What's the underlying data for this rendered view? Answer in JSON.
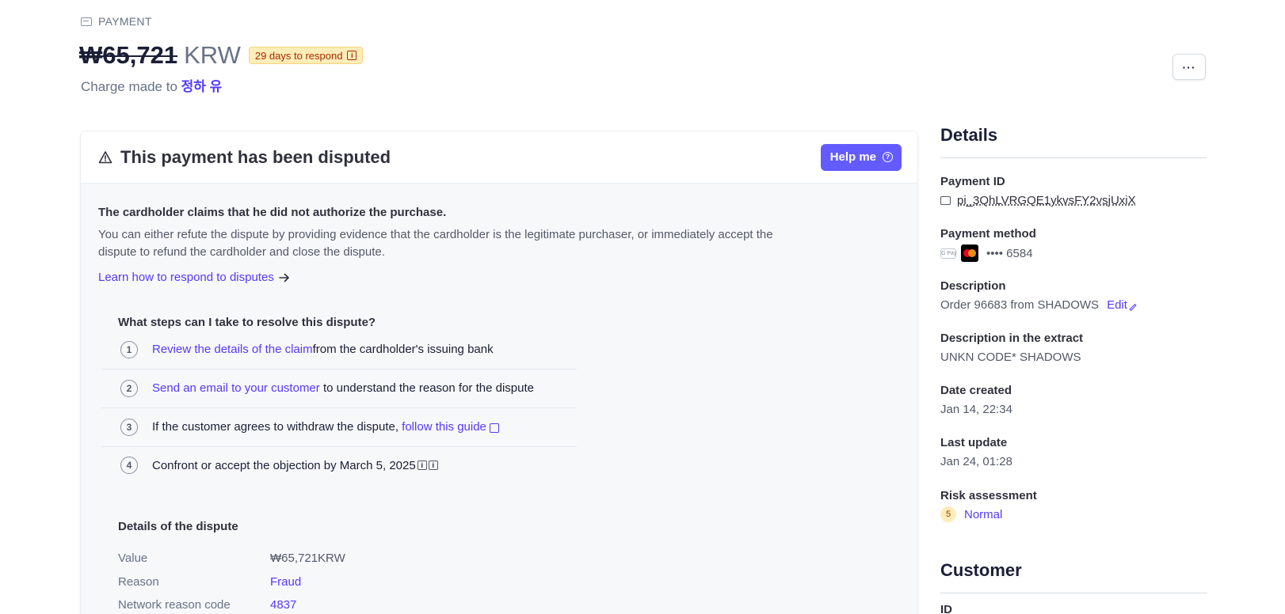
{
  "header": {
    "eyebrow": "PAYMENT",
    "amount": "₩65,721",
    "currency": "KRW",
    "deadline_badge": "29 days to respond",
    "charge_prefix": "Charge made to",
    "customer_name": "정하 유",
    "more_label": "···"
  },
  "dispute": {
    "title": "This payment has been disputed",
    "help_label": "Help me",
    "claim": "The cardholder claims that he did not authorize the purchase.",
    "explanation": "You can either refute the dispute by providing evidence that the cardholder is the legitimate purchaser, or immediately accept the dispute to refund the cardholder and close the dispute.",
    "learn_link": "Learn how to respond to disputes",
    "steps_title": "What steps can I take to resolve this dispute?",
    "steps": [
      {
        "number": "1",
        "link": "Review the details of the claim",
        "text": "from the cardholder's issuing bank"
      },
      {
        "number": "2",
        "link": "Send an email to your customer",
        "text": " to understand the reason for the dispute"
      },
      {
        "number": "3",
        "text": "If the customer agrees to withdraw the dispute, ",
        "link": "follow this guide"
      },
      {
        "number": "4",
        "text": "Confront or accept the objection by March 5, 2025"
      }
    ],
    "details_title": "Details of the dispute",
    "details": [
      {
        "label": "Value",
        "value": "₩65,721KRW"
      },
      {
        "label": "Reason",
        "value": "Fraud"
      },
      {
        "label": "Network reason code",
        "value": "4837"
      }
    ]
  },
  "details_panel": {
    "title": "Details",
    "payment_id_label": "Payment ID",
    "payment_id": "pi_3QhLVRGQE1ykvsFY2vsjUxiX",
    "payment_method_label": "Payment method",
    "gpay": "G Pay",
    "card_last4": "•••• 6584",
    "description_label": "Description",
    "description": "Order 96683 from SHADOWS",
    "edit_label": "Edit",
    "extract_label": "Description in the extract",
    "extract": "UNKN CODE* SHADOWS",
    "date_created_label": "Date created",
    "date_created": "Jan 14, 22:34",
    "last_update_label": "Last update",
    "last_update": "Jan 24, 01:28",
    "risk_label": "Risk assessment",
    "risk_score": "5",
    "risk_level": "Normal"
  },
  "customer_panel": {
    "title": "Customer",
    "id_label": "ID"
  },
  "colors": {
    "accent": "#533afd",
    "button": "#635bff",
    "warning_bg": "#fcedb9",
    "warning_text": "#a82c00"
  }
}
